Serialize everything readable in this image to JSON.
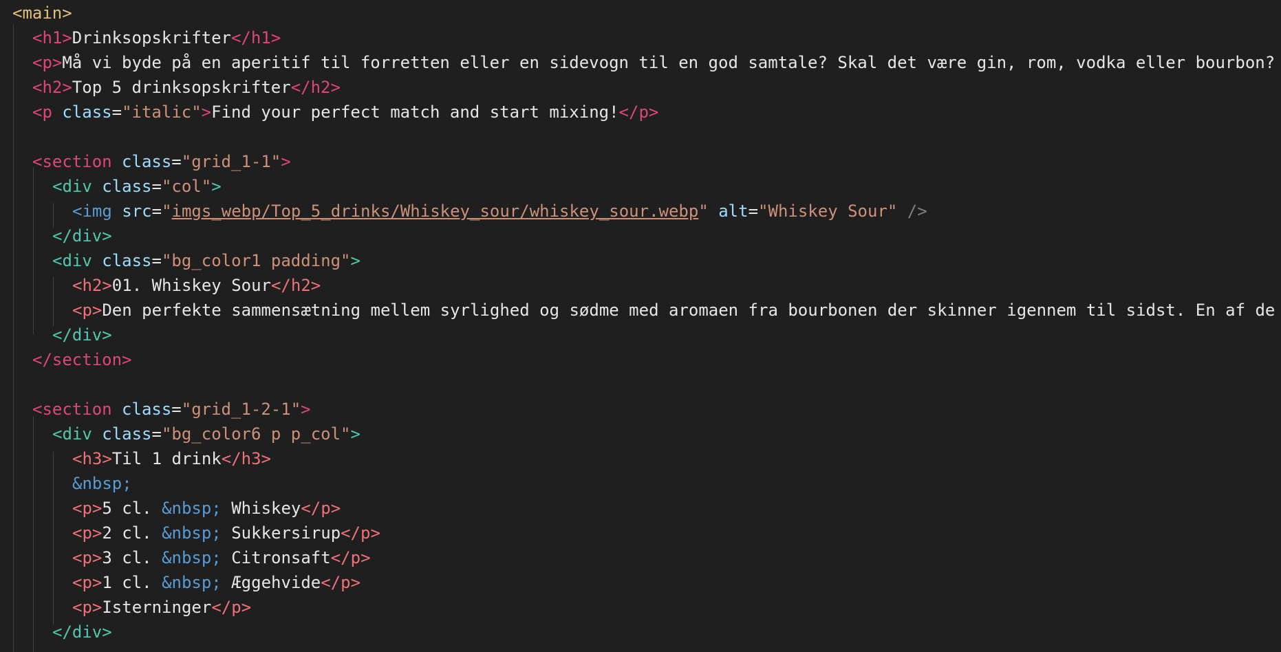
{
  "colors": {
    "background": "#1f1f1f",
    "tag_main": "#e5c07b",
    "tag_pink": "#e0447c",
    "tag_div": "#4ec9b0",
    "attribute": "#9cdcfe",
    "string": "#ce9178",
    "entity": "#569cd6",
    "text": "#e6e6e6"
  },
  "code": {
    "l1": {
      "main": "<main>"
    },
    "l2": {
      "open": "<h1>",
      "text": "Drinksopskrifter",
      "close": "</h1>"
    },
    "l3": {
      "open": "<p>",
      "text": "Må vi byde på en aperitif til forretten eller en sidevogn til en god samtale? Skal det være gin, rom, vodka eller bourbon?"
    },
    "l4": {
      "open": "<h2>",
      "text": "Top 5 drinksopskrifter",
      "close": "</h2>"
    },
    "l5": {
      "p_open": "<p",
      "attr": "class",
      "eq": "=",
      "q1": "\"",
      "val": "italic",
      "q2": "\"",
      "gt": ">",
      "text": "Find your perfect match and start mixing!",
      "close": "</p>"
    },
    "l7": {
      "open": "<section",
      "attr": "class",
      "eq": "=",
      "q1": "\"",
      "val": "grid_1-1",
      "q2": "\"",
      "gt": ">"
    },
    "l8": {
      "open": "<div",
      "attr": "class",
      "eq": "=",
      "q1": "\"",
      "val": "col",
      "q2": "\"",
      "gt": ">"
    },
    "l9": {
      "open": "<img",
      "attr1": "src",
      "eq1": "=",
      "q1": "\"",
      "src": "imgs_webp/Top_5_drinks/Whiskey_sour/whiskey_sour.webp",
      "q2": "\"",
      "attr2": "alt",
      "eq2": "=",
      "q3": "\"",
      "alt": "Whiskey Sour",
      "q4": "\"",
      "end": "/>"
    },
    "l10": {
      "close": "</div>"
    },
    "l11": {
      "open": "<div",
      "attr": "class",
      "eq": "=",
      "q1": "\"",
      "val": "bg_color1 padding",
      "q2": "\"",
      "gt": ">"
    },
    "l12": {
      "open": "<h2>",
      "text": "01. Whiskey Sour",
      "close": "</h2>"
    },
    "l13": {
      "open": "<p>",
      "text": "Den perfekte sammensætning mellem syrlighed og sødme med aromaen fra bourbonen der skinner igennem til sidst. En af de"
    },
    "l14": {
      "close": "</div>"
    },
    "l15": {
      "close": "</section>"
    },
    "l17": {
      "open": "<section",
      "attr": "class",
      "eq": "=",
      "q1": "\"",
      "val": "grid_1-2-1",
      "q2": "\"",
      "gt": ">"
    },
    "l18": {
      "open": "<div",
      "attr": "class",
      "eq": "=",
      "q1": "\"",
      "val": "bg_color6 p p_col",
      "q2": "\"",
      "gt": ">"
    },
    "l19": {
      "open": "<h3>",
      "text": "Til 1 drink",
      "close": "</h3>"
    },
    "l20": {
      "entity": "&nbsp;"
    },
    "ingredients": [
      {
        "open": "<p>",
        "amount": "5 cl. ",
        "entity": "&nbsp;",
        "name": " Whiskey",
        "close": "</p>"
      },
      {
        "open": "<p>",
        "amount": "2 cl. ",
        "entity": "&nbsp;",
        "name": " Sukkersirup",
        "close": "</p>"
      },
      {
        "open": "<p>",
        "amount": "3 cl. ",
        "entity": "&nbsp;",
        "name": " Citronsaft",
        "close": "</p>"
      },
      {
        "open": "<p>",
        "amount": "1 cl. ",
        "entity": "&nbsp;",
        "name": " Æggehvide",
        "close": "</p>"
      }
    ],
    "l25": {
      "open": "<p>",
      "text": "Isterninger",
      "close": "</p>"
    },
    "l26": {
      "close": "</div>"
    }
  }
}
